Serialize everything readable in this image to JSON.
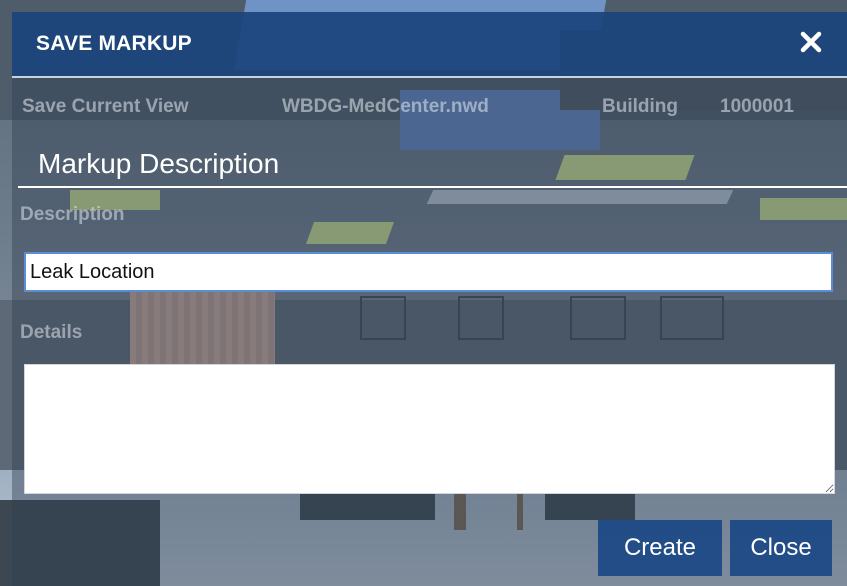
{
  "dialog": {
    "title": "SAVE MARKUP",
    "close_icon": "close-icon"
  },
  "info": {
    "view_label": "Save Current View",
    "model": "WBDG-MedCenter.nwd",
    "category": "Building",
    "id": "1000001"
  },
  "section": {
    "heading": "Markup Description"
  },
  "form": {
    "description_label": "Description",
    "description_value": "Leak Location",
    "details_label": "Details",
    "details_value": ""
  },
  "buttons": {
    "create_label": "Create",
    "close_label": "Close"
  },
  "colors": {
    "header_bg": "#1c457d",
    "button_bg": "#1b4884",
    "input_border": "#5b8cd6"
  }
}
